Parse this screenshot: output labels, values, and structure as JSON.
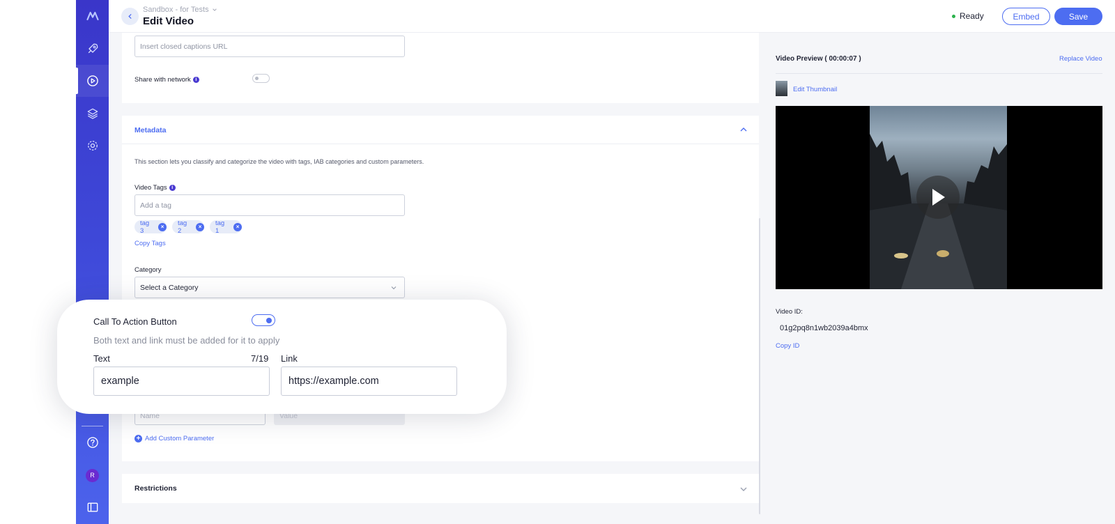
{
  "header": {
    "breadcrumb": "Sandbox - for Tests",
    "title": "Edit Video",
    "status": "Ready",
    "embed_label": "Embed",
    "save_label": "Save"
  },
  "captions": {
    "placeholder": "Insert closed captions URL",
    "share_label": "Share with network",
    "share_enabled": false
  },
  "metadata": {
    "title": "Metadata",
    "description": "This section lets you classify and categorize the video with tags, IAB categories and custom parameters.",
    "tags_label": "Video Tags",
    "tags_placeholder": "Add a tag",
    "tags": [
      "tag 3",
      "tag 2",
      "tag 1"
    ],
    "copy_tags": "Copy Tags",
    "category_label": "Category",
    "category_value": "Select a Category",
    "param_name_placeholder": "Name",
    "param_value_placeholder": "Value",
    "add_param": "Add Custom Parameter"
  },
  "restrictions": {
    "title": "Restrictions"
  },
  "preview": {
    "title": "Video Preview ( 00:00:07 )",
    "replace": "Replace Video",
    "edit_thumbnail": "Edit Thumbnail",
    "video_id_label": "Video ID:",
    "video_id": "01g2pq8n1wb2039a4bmx",
    "copy_id": "Copy ID"
  },
  "cta": {
    "title": "Call To Action Button",
    "enabled": true,
    "hint": "Both text and link must be added for it to apply",
    "text_label": "Text",
    "text_count": "7/19",
    "text_value": "example",
    "link_label": "Link",
    "link_value": "https://example.com"
  },
  "user": {
    "avatar_initial": "R"
  },
  "colors": {
    "accent": "#4d6df1",
    "sidebar": "#3a36c9",
    "ready": "#2bb24c"
  }
}
